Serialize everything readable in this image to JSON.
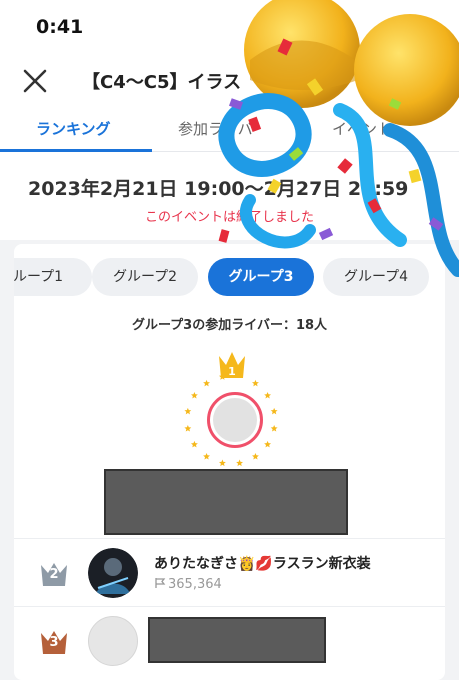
{
  "status_bar": {
    "time": "0:41"
  },
  "header": {
    "title": "【C4〜C5】イラス",
    "close_icon": "close-icon"
  },
  "tabs": [
    {
      "label": "ランキング",
      "active": true
    },
    {
      "label": "参加ライバ",
      "active": false
    },
    {
      "label": "イベント",
      "active": false
    }
  ],
  "event": {
    "period": "2023年2月21日 19:00〜2月27日 23:59",
    "ended_notice": "このイベントは終了しました"
  },
  "group_chips": [
    {
      "label": "ループ1",
      "active": false
    },
    {
      "label": "グループ2",
      "active": false
    },
    {
      "label": "グループ3",
      "active": true
    },
    {
      "label": "グループ4",
      "active": false
    }
  ],
  "group_summary": "グループ3の参加ライバー：18人",
  "podium": {
    "rank": "1",
    "crown_color": "#f5b81c",
    "ring_color": "#f0506a"
  },
  "ranking_rows": [
    {
      "rank": "2",
      "name": "ありたなぎさ👸💋ラスラン新衣装",
      "points": "365,364",
      "badge_color": "#8e9aa6"
    },
    {
      "rank": "3",
      "name": "",
      "points": "",
      "badge_color": "#b5603a"
    }
  ],
  "colors": {
    "accent": "#1a73d9",
    "alert": "#e8344c"
  }
}
